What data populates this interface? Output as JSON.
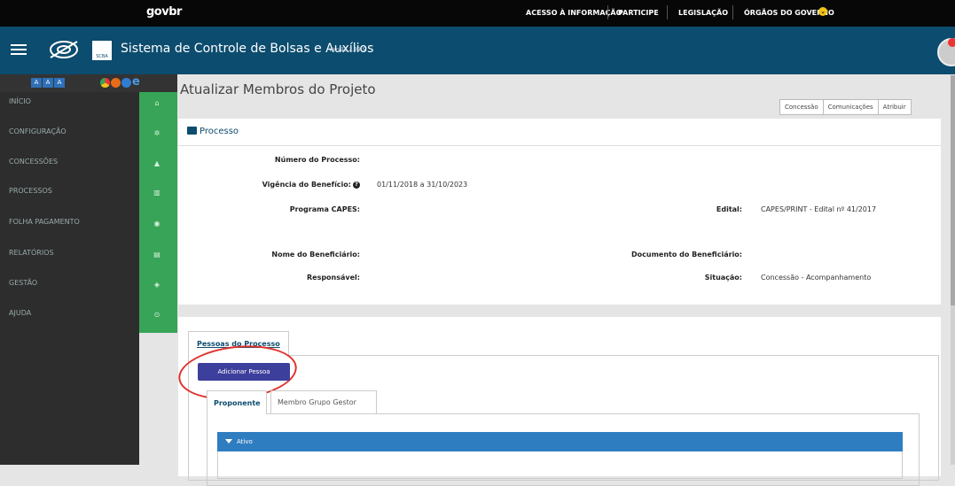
{
  "govbar": {
    "logo": "govbr",
    "links": [
      "ACESSO À INFORMAÇÃO",
      "PARTICIPE",
      "LEGISLAÇÃO",
      "ÓRGÃOS DO GOVERNO"
    ]
  },
  "header": {
    "badge": "SCBA",
    "title": "Sistema de Controle de Bolsas e Auxílios",
    "version": "Versão 2.39.5."
  },
  "accessibility": {
    "buttons": [
      "A",
      "A",
      "A"
    ]
  },
  "sidebar": {
    "items": [
      {
        "label": "INÍCIO",
        "icon": "home-icon",
        "glyph": "⌂"
      },
      {
        "label": "CONFIGURAÇÃO",
        "icon": "gear-icon",
        "glyph": "✲"
      },
      {
        "label": "CONCESSÕES",
        "icon": "cap-icon",
        "glyph": "▲"
      },
      {
        "label": "PROCESSOS",
        "icon": "books-icon",
        "glyph": "▥"
      },
      {
        "label": "FOLHA PAGAMENTO",
        "icon": "money-icon",
        "glyph": "◉"
      },
      {
        "label": "RELATÓRIOS",
        "icon": "report-icon",
        "glyph": "▤"
      },
      {
        "label": "GESTÃO",
        "icon": "layers-icon",
        "glyph": "◈"
      },
      {
        "label": "AJUDA",
        "icon": "help-icon",
        "glyph": "⊙"
      }
    ]
  },
  "page": {
    "title": "Atualizar Membros do Projeto",
    "buttons": [
      "Concessão",
      "Comunicações",
      "Atribuir"
    ]
  },
  "processo": {
    "heading": "Processo",
    "numero_label": "Número do Processo:",
    "numero_value": "",
    "vigencia_label": "Vigência do Benefício:",
    "vigencia_value": "01/11/2018 a 31/10/2023",
    "programa_label": "Programa CAPES:",
    "programa_value": "",
    "edital_label": "Edital:",
    "edital_value": "CAPES/PRINT - Edital nº 41/2017",
    "nome_label": "Nome do Beneficiário:",
    "nome_value": "",
    "documento_label": "Documento do Beneficiário:",
    "documento_value": "",
    "responsavel_label": "Responsável:",
    "responsavel_value": "",
    "situacao_label": "Situação:",
    "situacao_value": "Concessão - Acompanhamento"
  },
  "pessoas": {
    "tab_label": "Pessoas do Processo",
    "add_button": "Adicionar Pessoa",
    "subtabs": [
      "Proponente",
      "Membro Grupo Gestor"
    ],
    "section": "Ativo"
  },
  "colors": {
    "govbar": "#070707",
    "header": "#0c4c6e",
    "sidebar": "#2d2d2d",
    "sidebar_icons": "#37a457",
    "add_button": "#3d3f9c",
    "section_bar": "#2f7dc1",
    "highlight_ring": "#e0322c"
  }
}
